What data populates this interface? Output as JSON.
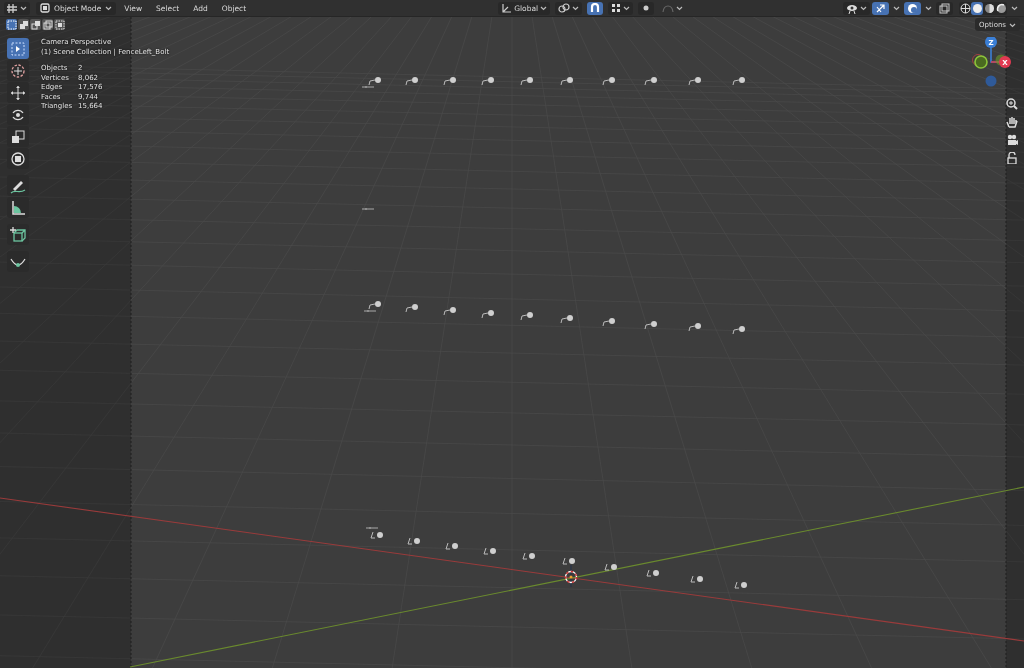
{
  "header": {
    "mode": "Object Mode",
    "menus": [
      "View",
      "Select",
      "Add",
      "Object"
    ],
    "orientation": "Global",
    "snap": {
      "on": true
    },
    "proportional": {
      "on": false
    },
    "gizmos": {
      "on": true
    },
    "overlays": {
      "on": true
    },
    "xray": {
      "on": false
    },
    "shading": [
      {
        "kind": "wireframe",
        "selected": false
      },
      {
        "kind": "solid",
        "selected": true
      },
      {
        "kind": "material",
        "selected": false
      },
      {
        "kind": "rendered",
        "selected": false
      }
    ]
  },
  "select_modes": [
    {
      "kind": "new",
      "selected": true
    },
    {
      "kind": "extend",
      "selected": false
    },
    {
      "kind": "subtract",
      "selected": false
    },
    {
      "kind": "invert",
      "selected": false
    },
    {
      "kind": "intersect",
      "selected": false
    }
  ],
  "tool_groups": [
    [
      {
        "kind": "select",
        "selected": true
      },
      {
        "kind": "cursor",
        "selected": false
      },
      {
        "kind": "move",
        "selected": false
      },
      {
        "kind": "rotate",
        "selected": false
      },
      {
        "kind": "scale",
        "selected": false
      },
      {
        "kind": "transform",
        "selected": false
      }
    ],
    [
      {
        "kind": "annotate",
        "selected": false
      },
      {
        "kind": "measure",
        "selected": false
      }
    ],
    [
      {
        "kind": "add_cube",
        "selected": false
      }
    ],
    [
      {
        "kind": "curve",
        "selected": false
      }
    ]
  ],
  "overlay_text": {
    "view": "Camera Perspective",
    "context": "(1) Scene Collection | FenceLeft_Bolt"
  },
  "stats": [
    {
      "label": "Objects",
      "value": "2"
    },
    {
      "label": "Vertices",
      "value": "8,062"
    },
    {
      "label": "Edges",
      "value": "17,576"
    },
    {
      "label": "Faces",
      "value": "9,744"
    },
    {
      "label": "Triangles",
      "value": "15,664"
    }
  ],
  "options": "Options",
  "gizmo": {
    "z": "Z",
    "x": "X"
  },
  "nav_buttons": [
    {
      "kind": "zoom"
    },
    {
      "kind": "pan"
    },
    {
      "kind": "camera"
    },
    {
      "kind": "lock"
    }
  ]
}
